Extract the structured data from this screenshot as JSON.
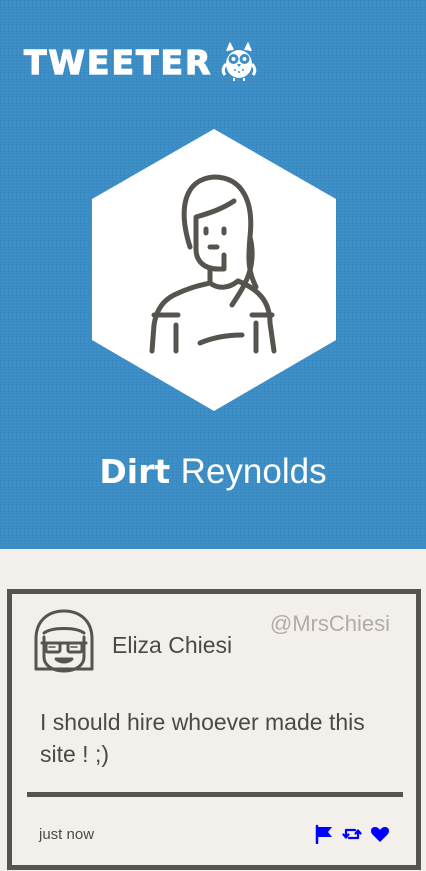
{
  "brand": {
    "name": "TWEETER",
    "logo_icon": "owl-icon"
  },
  "profile": {
    "first_name": "Dirt",
    "last_name": "Reynolds",
    "avatar_icon": "woman-avatar-icon"
  },
  "tweet": {
    "author_name": "Eliza Chiesi",
    "handle": "@MrsChiesi",
    "text": "I should hire whoever made this site ! ;)",
    "timestamp": "just now",
    "avatar_icon": "girl-sunglasses-avatar-icon",
    "actions": [
      {
        "name": "flag",
        "icon": "flag-icon"
      },
      {
        "name": "retweet",
        "icon": "retweet-icon"
      },
      {
        "name": "like",
        "icon": "heart-icon"
      }
    ]
  },
  "colors": {
    "hero_bg": "#3a8dc6",
    "page_bg": "#f3f0eb",
    "card_border": "#57534e",
    "action_blue": "#0000ff"
  }
}
